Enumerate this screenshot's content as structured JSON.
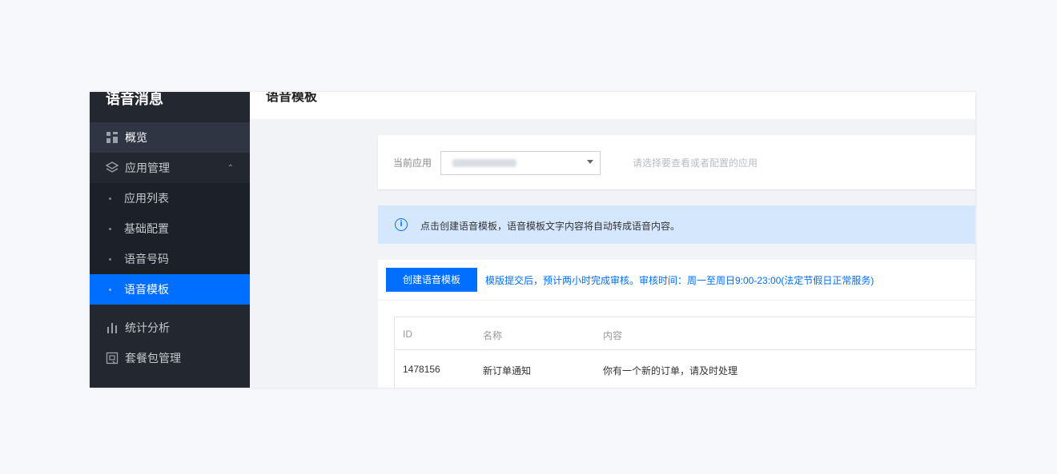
{
  "sidebar": {
    "title": "语音消息",
    "items": {
      "overview": "概览",
      "app_manage": "应用管理",
      "app_list": "应用列表",
      "basic_config": "基础配置",
      "voice_number": "语音号码",
      "voice_template": "语音模板",
      "stats": "统计分析",
      "packages": "套餐包管理"
    }
  },
  "header": {
    "title": "语音模板"
  },
  "app_selector": {
    "label": "当前应用",
    "hint": "请选择要查看或者配置的应用"
  },
  "notice": {
    "text": "点击创建语音模板，语音模板文字内容将自动转成语音内容。"
  },
  "toolbar": {
    "create_label": "创建语音模板",
    "tip": "模版提交后，预计两小时完成审核。审核时间：周一至周日9:00-23:00(法定节假日正常服务)"
  },
  "table": {
    "columns": [
      "ID",
      "名称",
      "内容"
    ],
    "rows": [
      {
        "id": "1478156",
        "name": "新订单通知",
        "content": "你有一个新的订单，请及时处理"
      }
    ]
  },
  "colors": {
    "accent": "#006eff",
    "sidebar_bg": "#232730",
    "notice_bg": "#d5e7fd"
  },
  "icons": [
    "grid-icon",
    "layers-icon",
    "bar-chart-icon",
    "package-icon",
    "info-icon",
    "caret-down-icon",
    "chevron-up-icon"
  ]
}
